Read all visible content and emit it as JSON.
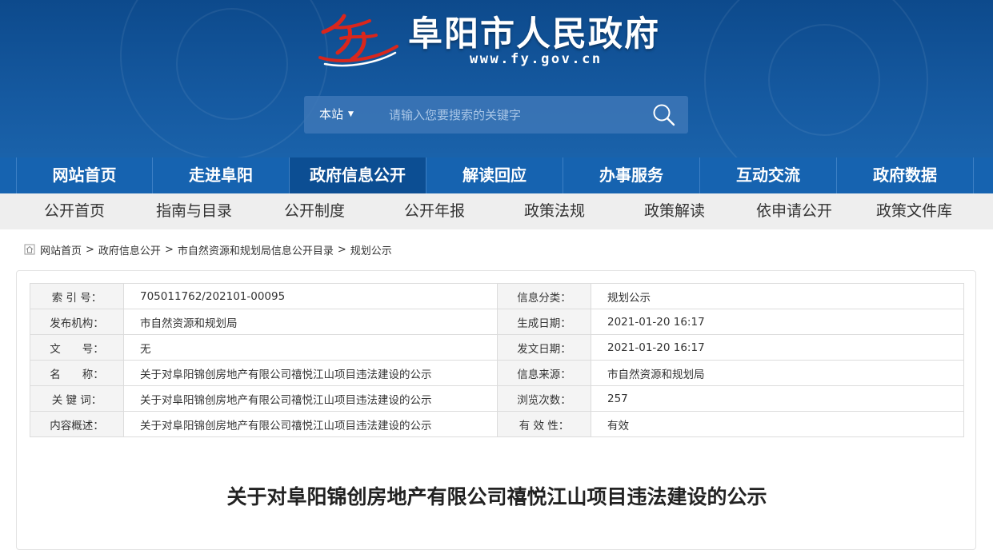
{
  "header": {
    "site_title": "阜阳市人民政府",
    "site_url": "www.fy.gov.cn",
    "logo_icon": "fuyang-logo-icon",
    "search": {
      "scope": "本站",
      "placeholder": "请输入您要搜索的关键字",
      "icon": "search-icon"
    }
  },
  "main_nav": {
    "items": [
      "网站首页",
      "走进阜阳",
      "政府信息公开",
      "解读回应",
      "办事服务",
      "互动交流",
      "政府数据"
    ],
    "active_index": 2
  },
  "sub_nav": {
    "items": [
      "公开首页",
      "指南与目录",
      "公开制度",
      "公开年报",
      "政策法规",
      "政策解读",
      "依申请公开",
      "政策文件库"
    ]
  },
  "breadcrumb": {
    "icon": "home-icon",
    "items": [
      "网站首页",
      "政府信息公开",
      "市自然资源和规划局信息公开目录",
      "规划公示"
    ],
    "separator": ">"
  },
  "meta": {
    "rows": [
      {
        "k1": "索 引 号：",
        "v1": "705011762/202101-00095",
        "k2": "信息分类：",
        "v2": "规划公示"
      },
      {
        "k1": "发布机构：",
        "v1": "市自然资源和规划局",
        "k2": "生成日期：",
        "v2": "2021-01-20 16:17"
      },
      {
        "k1": "文　　号：",
        "v1": "无",
        "k2": "发文日期：",
        "v2": "2021-01-20 16:17"
      },
      {
        "k1": "名　　称：",
        "v1": "关于对阜阳锦创房地产有限公司禧悦江山项目违法建设的公示",
        "k2": "信息来源：",
        "v2": "市自然资源和规划局"
      },
      {
        "k1": "关 键 词：",
        "v1": "关于对阜阳锦创房地产有限公司禧悦江山项目违法建设的公示",
        "k2": "浏览次数：",
        "v2": "257"
      },
      {
        "k1": "内容概述：",
        "v1": "关于对阜阳锦创房地产有限公司禧悦江山项目违法建设的公示",
        "k2": "有 效 性：",
        "v2": "有效"
      }
    ]
  },
  "article": {
    "title": "关于对阜阳锦创房地产有限公司禧悦江山项目违法建设的公示"
  },
  "colors": {
    "header_bg": "#1559a0",
    "nav_bg": "#1663b0",
    "nav_active_bg": "#0c4e93",
    "subnav_bg": "#eeeeee",
    "logo_red": "#d9261c"
  }
}
